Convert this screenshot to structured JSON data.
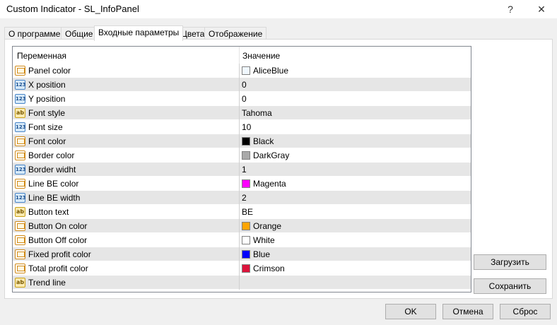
{
  "window": {
    "title": "Custom Indicator - SL_InfoPanel",
    "help_glyph": "?",
    "close_glyph": "✕"
  },
  "tabs": [
    {
      "label": "О программе"
    },
    {
      "label": "Общие"
    },
    {
      "label": "Входные параметры"
    },
    {
      "label": "Цвета"
    },
    {
      "label": "Отображение"
    }
  ],
  "grid": {
    "col_variable": "Переменная",
    "col_value": "Значение",
    "rows": [
      {
        "name": "Panel color",
        "type": "color",
        "value": "AliceBlue",
        "swatch": "#f0f8ff"
      },
      {
        "name": "X position",
        "type": "int",
        "value": "0"
      },
      {
        "name": "Y position",
        "type": "int",
        "value": "0"
      },
      {
        "name": "Font style",
        "type": "str",
        "value": "Tahoma"
      },
      {
        "name": "Font size",
        "type": "int",
        "value": "10"
      },
      {
        "name": "Font color",
        "type": "color",
        "value": "Black",
        "swatch": "#000000"
      },
      {
        "name": "Border color",
        "type": "color",
        "value": "DarkGray",
        "swatch": "#a9a9a9"
      },
      {
        "name": "Border widht",
        "type": "int",
        "value": "1"
      },
      {
        "name": "Line BE color",
        "type": "color",
        "value": "Magenta",
        "swatch": "#ff00ff"
      },
      {
        "name": "Line BE width",
        "type": "int",
        "value": "2"
      },
      {
        "name": "Button text",
        "type": "str",
        "value": "BE"
      },
      {
        "name": "Button On color",
        "type": "color",
        "value": "Orange",
        "swatch": "#ffa500"
      },
      {
        "name": "Button Off color",
        "type": "color",
        "value": "White",
        "swatch": "#ffffff"
      },
      {
        "name": "Fixed profit color",
        "type": "color",
        "value": "Blue",
        "swatch": "#0000ff"
      },
      {
        "name": "Total profit color",
        "type": "color",
        "value": "Crimson",
        "swatch": "#dc143c"
      },
      {
        "name": "Trend line",
        "type": "str",
        "value": ""
      }
    ]
  },
  "buttons": {
    "load": "Загрузить",
    "save": "Сохранить",
    "ok": "OK",
    "cancel": "Отмена",
    "reset": "Сброс"
  }
}
